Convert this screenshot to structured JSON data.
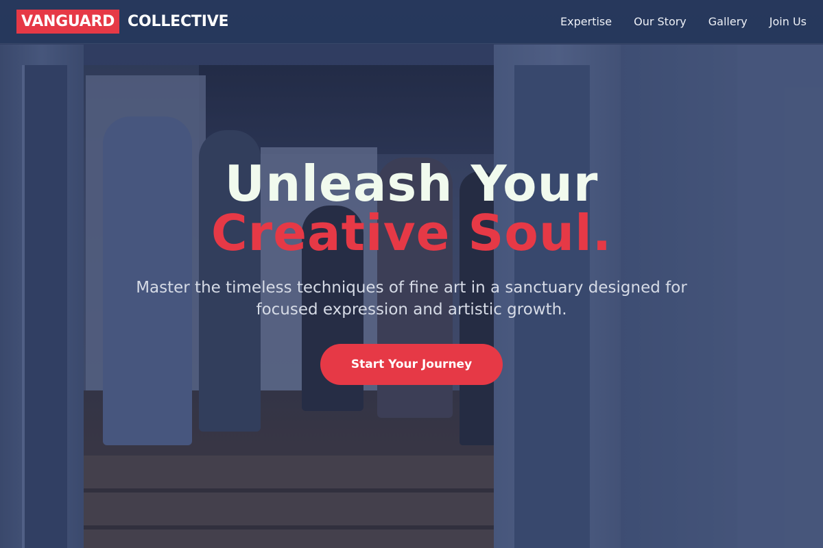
{
  "header": {
    "brand_mark": "VANGUARD",
    "brand_name": "COLLECTIVE",
    "nav": [
      {
        "label": "Expertise"
      },
      {
        "label": "Our Story"
      },
      {
        "label": "Gallery"
      },
      {
        "label": "Join Us"
      }
    ]
  },
  "hero": {
    "title_line1": "Unleash Your",
    "title_line2": "Creative Soul.",
    "subtitle": "Master the timeless techniques of fine art in a sanctuary designed for focused expression and artistic growth.",
    "cta_label": "Start Your Journey"
  },
  "colors": {
    "accent": "#e63946",
    "title_light": "#f1faee",
    "header_bg": "#26375c"
  }
}
